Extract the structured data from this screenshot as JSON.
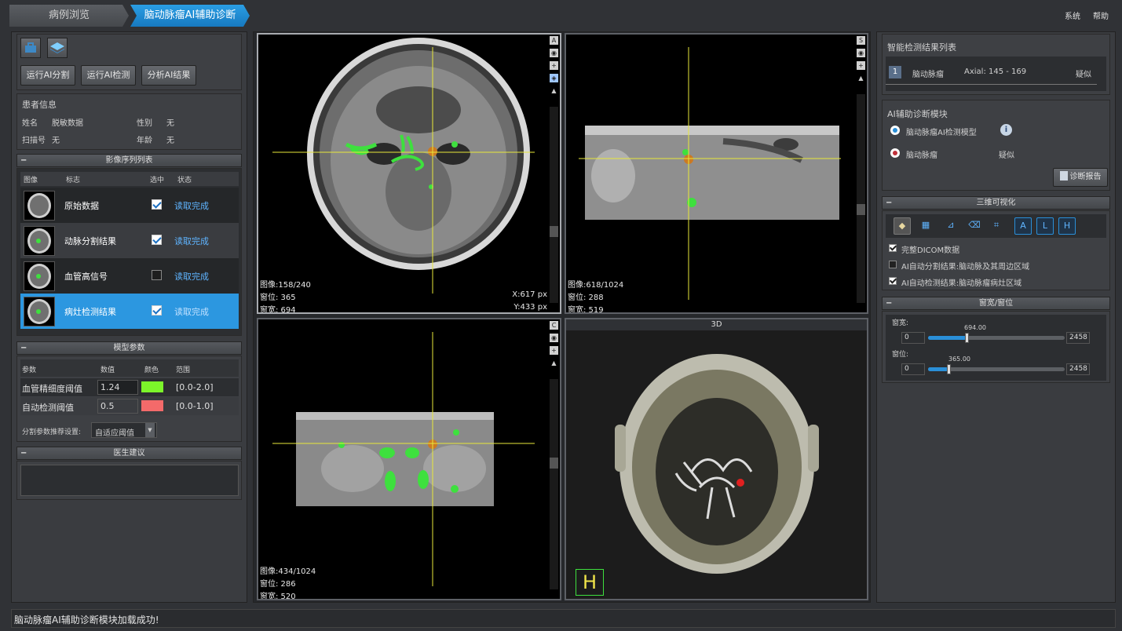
{
  "tabs": [
    "病例浏览",
    "脑动脉瘤AI辅助诊断"
  ],
  "topmenu": {
    "system": "系统",
    "help": "帮助"
  },
  "actions": {
    "run_seg": "运行AI分割",
    "run_detect": "运行AI检测",
    "analyze": "分析AI结果"
  },
  "patient": {
    "title": "患者信息",
    "name_label": "姓名",
    "name_value": "脱敏数据",
    "sex_label": "性别",
    "sex_value": "无",
    "scan_label": "扫描号",
    "scan_value": "无",
    "age_label": "年龄",
    "age_value": "无"
  },
  "series": {
    "title": "影像序列列表",
    "headers": [
      "图像",
      "标志",
      "选中",
      "状态"
    ],
    "rows": [
      {
        "name": "原始数据",
        "checked": true,
        "status": "读取完成"
      },
      {
        "name": "动脉分割结果",
        "checked": true,
        "status": "读取完成"
      },
      {
        "name": "血管高信号",
        "checked": false,
        "status": "读取完成"
      },
      {
        "name": "病灶检测结果",
        "checked": true,
        "status": "读取完成"
      }
    ]
  },
  "model_params": {
    "title": "模型参数",
    "headers": [
      "参数",
      "数值",
      "颜色",
      "范围"
    ],
    "rows": [
      {
        "name": "血管精细度阈值",
        "value": "1.24",
        "color": "#7cf52a",
        "range": "[0.0-2.0]"
      },
      {
        "name": "自动检测阈值",
        "value": "0.5",
        "color": "#f46a6a",
        "range": "[0.0-1.0]"
      }
    ],
    "preset_label": "分割参数推荐设置:",
    "preset_value": "自适应阈值"
  },
  "doctor": {
    "title": "医生建议"
  },
  "viewports": {
    "axial": {
      "tag": "A",
      "image": "图像:158/240",
      "wl": "窗位: 365",
      "ww": "窗宽: 694",
      "x": "X:617 px",
      "y": "Y:433 px"
    },
    "sagittal": {
      "tag": "S",
      "image": "图像:618/1024",
      "wl": "窗位: 288",
      "ww": "窗宽: 519"
    },
    "coronal": {
      "tag": "C",
      "image": "图像:434/1024",
      "wl": "窗位: 286",
      "ww": "窗宽: 520"
    },
    "vr": {
      "title": "3D",
      "orient": "H"
    }
  },
  "results": {
    "title": "智能检测结果列表",
    "items": [
      {
        "index": "1",
        "name": "脑动脉瘤",
        "location": "Axial: 145 - 169",
        "verdict": "疑似"
      }
    ]
  },
  "diag": {
    "title": "AI辅助诊断模块",
    "model_label": "脑动脉瘤AI检测模型",
    "result_label": "脑动脉瘤",
    "result_value": "疑似",
    "report_button": "诊断报告"
  },
  "vis3d": {
    "title": "三维可视化",
    "options": [
      {
        "label": "完整DICOM数据",
        "checked": true
      },
      {
        "label": "AI自动分割结果:脑动脉及其周边区域",
        "checked": false
      },
      {
        "label": "AI自动检测结果:脑动脉瘤病灶区域",
        "checked": true
      }
    ]
  },
  "window": {
    "title": "窗宽/窗位",
    "width_label": "窗宽:",
    "width_min": "0",
    "width_max": "2458",
    "width_value": "694.00",
    "width_fraction": 0.282,
    "level_label": "窗位:",
    "level_min": "0",
    "level_max": "2458",
    "level_value": "365.00",
    "level_fraction": 0.148
  },
  "status_text": "脑动脉瘤AI辅助诊断模块加载成功!"
}
